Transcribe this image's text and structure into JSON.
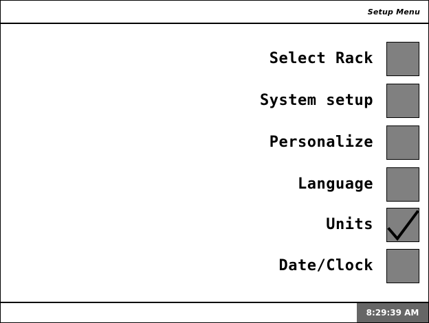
{
  "header": {
    "title": "Setup Menu"
  },
  "menu": {
    "items": [
      {
        "label": "Select Rack",
        "checked": false
      },
      {
        "label": "System setup",
        "checked": false
      },
      {
        "label": "Personalize",
        "checked": false
      },
      {
        "label": "Language",
        "checked": false
      },
      {
        "label": "Units",
        "checked": true
      },
      {
        "label": "Date/Clock",
        "checked": false
      }
    ]
  },
  "status": {
    "clock": "8:29:39 AM"
  },
  "colors": {
    "button_fill": "#808080",
    "clock_bg": "#666666",
    "clock_text": "#ffffff"
  }
}
